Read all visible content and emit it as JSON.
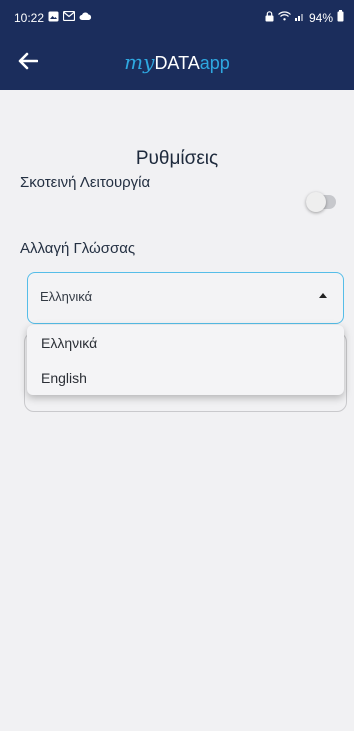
{
  "status_bar": {
    "time": "10:22",
    "left_icons": [
      "gallery-icon",
      "gmail-icon",
      "cloud-icon"
    ],
    "battery": "94%"
  },
  "app_bar": {
    "logo_my": "my",
    "logo_data": "DATA",
    "logo_app": "app"
  },
  "page": {
    "title": "Ρυθμίσεις",
    "dark_mode_label": "Σκοτεινή Λειτουργία",
    "dark_mode_on": false,
    "language_label": "Αλλαγή Γλώσσας",
    "language_selected": "Ελληνικά"
  },
  "language_menu": {
    "options": [
      "Ελληνικά",
      "English"
    ]
  },
  "colors": {
    "header": "#1b2d5c",
    "accent": "#2ea7e0",
    "select_border": "#55bde8"
  }
}
